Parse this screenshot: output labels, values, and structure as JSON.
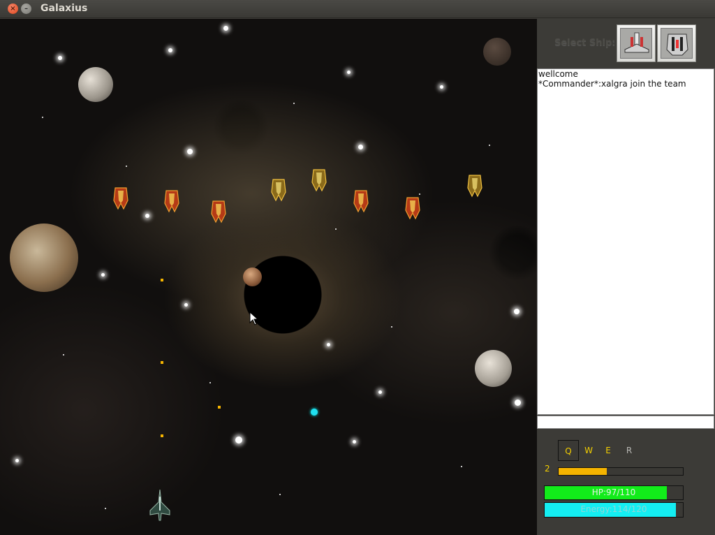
{
  "window": {
    "title": "Galaxius"
  },
  "panel": {
    "select_ship_label": "Select Ship:",
    "ships": [
      {
        "icon": "fighter-ship-icon"
      },
      {
        "icon": "heavy-ship-icon"
      }
    ]
  },
  "chat": {
    "messages": [
      "wellcome",
      "*Commander*:xalgra join the team"
    ],
    "input_value": ""
  },
  "skills": {
    "q": "Q",
    "w": "W",
    "e": "E",
    "r": "R"
  },
  "stats": {
    "level": "2",
    "xp_fraction": 0.39,
    "hp_text": "HP:97/110",
    "hp_fraction": 0.882,
    "energy_text": "Energy:114/120",
    "energy_fraction": 0.95
  },
  "colors": {
    "hp": "#12ec1a",
    "energy": "#14eef2",
    "xp": "#f5b400",
    "skill_text": "#f5d000"
  }
}
